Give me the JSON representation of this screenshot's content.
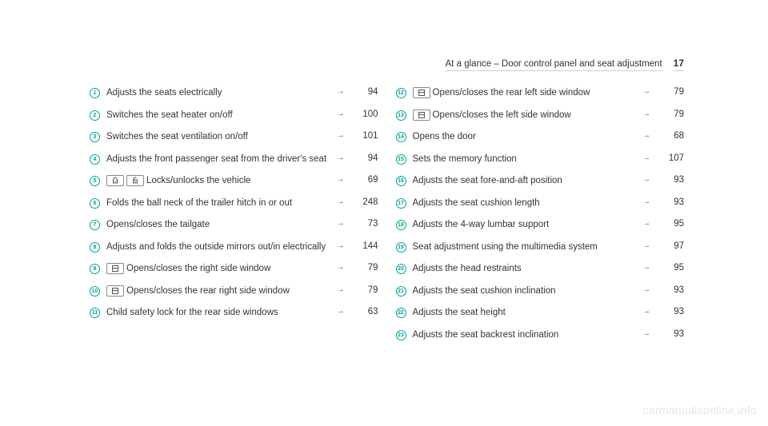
{
  "header": {
    "title": "At a glance – Door control panel and seat adjustment",
    "page": "17"
  },
  "left_column": [
    {
      "num": "1",
      "icons": [],
      "text": "Adjusts the seats electrically",
      "page": "94"
    },
    {
      "num": "2",
      "icons": [],
      "text": "Switches the seat heater on/off",
      "page": "100"
    },
    {
      "num": "3",
      "icons": [],
      "text": "Switches the seat ventilation on/off",
      "page": "101"
    },
    {
      "num": "4",
      "icons": [],
      "text": "Adjusts the front passenger seat from the driv­er's seat",
      "page": "94"
    },
    {
      "num": "5",
      "icons": [
        "lock",
        "unlock"
      ],
      "text": "Locks/unlocks the vehicle",
      "page": "69"
    },
    {
      "num": "6",
      "icons": [],
      "text": "Folds the ball neck of the trailer hitch in or out",
      "page": "248"
    },
    {
      "num": "7",
      "icons": [],
      "text": "Opens/closes the tailgate",
      "page": "73"
    },
    {
      "num": "8",
      "icons": [],
      "text": "Adjusts and folds the outside mirrors out/in electrically",
      "page": "144"
    },
    {
      "num": "9",
      "icons": [
        "window"
      ],
      "text": "Opens/closes the right side window",
      "page": "79"
    },
    {
      "num": "10",
      "icons": [
        "window"
      ],
      "text": "Opens/closes the rear right side window",
      "page": "79"
    },
    {
      "num": "11",
      "icons": [],
      "text": "Child safety lock for the rear side windows",
      "page": "63"
    }
  ],
  "right_column": [
    {
      "num": "12",
      "icons": [
        "window"
      ],
      "text": "Opens/closes the rear left side window",
      "page": "79"
    },
    {
      "num": "13",
      "icons": [
        "window"
      ],
      "text": "Opens/closes the left side window",
      "page": "79"
    },
    {
      "num": "14",
      "icons": [],
      "text": "Opens the door",
      "page": "68"
    },
    {
      "num": "15",
      "icons": [],
      "text": "Sets the memory function",
      "page": "107"
    },
    {
      "num": "16",
      "icons": [],
      "text": "Adjusts the seat fore-and-aft position",
      "page": "93"
    },
    {
      "num": "17",
      "icons": [],
      "text": "Adjusts the seat cushion length",
      "page": "93"
    },
    {
      "num": "18",
      "icons": [],
      "text": "Adjusts the 4-way lumbar support",
      "page": "95"
    },
    {
      "num": "19",
      "icons": [],
      "text": "Seat adjustment using the multimedia system",
      "page": "97"
    },
    {
      "num": "20",
      "icons": [],
      "text": "Adjusts the head restraints",
      "page": "95"
    },
    {
      "num": "21",
      "icons": [],
      "text": "Adjusts the seat cushion inclination",
      "page": "93"
    },
    {
      "num": "22",
      "icons": [],
      "text": "Adjusts the seat height",
      "page": "93"
    },
    {
      "num": "23",
      "icons": [],
      "text": "Adjusts the seat backrest inclination",
      "page": "93"
    }
  ],
  "arrow_char": "→",
  "watermark": "carmanualsonline.info"
}
